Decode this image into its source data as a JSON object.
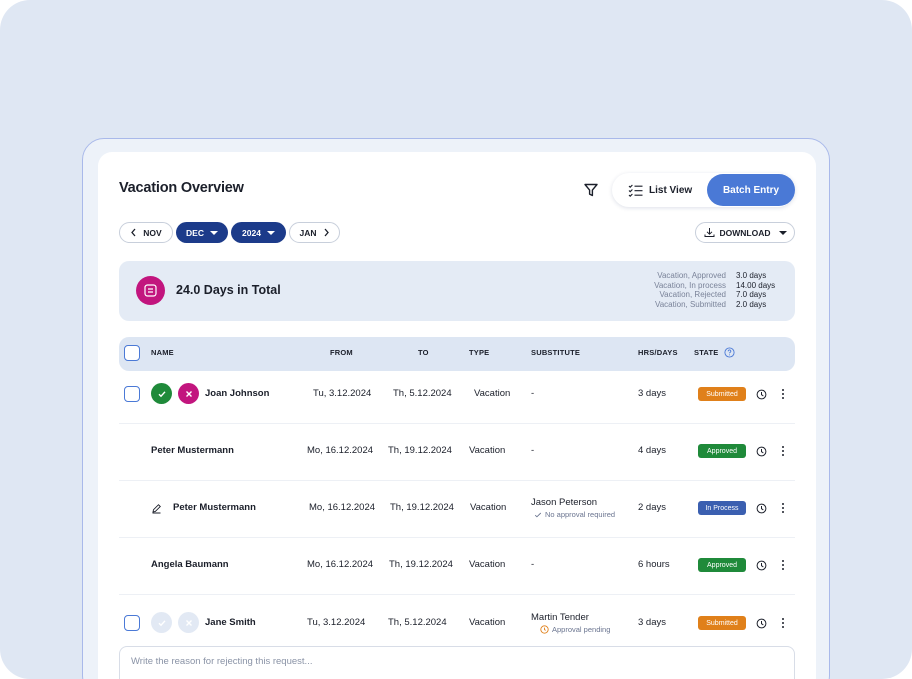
{
  "header": {
    "title": "Vacation Overview",
    "list_view_label": "List View",
    "batch_entry_label": "Batch Entry"
  },
  "period": {
    "prev_month": "NOV",
    "month": "DEC",
    "year": "2024",
    "next_month": "JAN",
    "download_label": "DOWNLOAD"
  },
  "summary": {
    "total": "24.0 Days in Total",
    "stats": [
      {
        "label": "Vacation, Approved",
        "value": "3.0 days"
      },
      {
        "label": "Vacation, In process",
        "value": "14.00 days"
      },
      {
        "label": "Vacation, Rejected",
        "value": "7.0 days"
      },
      {
        "label": "Vacation, Submitted",
        "value": "2.0 days"
      }
    ]
  },
  "table": {
    "columns": {
      "name": "NAME",
      "from": "FROM",
      "to": "TO",
      "type": "TYPE",
      "substitute": "SUBSTITUTE",
      "hrs": "HRS/DAYS",
      "state": "STATE"
    },
    "rows": [
      {
        "name": "Joan Johnson",
        "from": "Tu, 3.12.2024",
        "to": "Th, 5.12.2024",
        "type": "Vacation",
        "substitute": "-",
        "note": "",
        "hrs": "3 days",
        "state": "Submitted"
      },
      {
        "name": "Peter Mustermann",
        "from": "Mo, 16.12.2024",
        "to": "Th, 19.12.2024",
        "type": "Vacation",
        "substitute": "-",
        "note": "",
        "hrs": "4 days",
        "state": "Approved"
      },
      {
        "name": "Peter Mustermann",
        "from": "Mo, 16.12.2024",
        "to": "Th, 19.12.2024",
        "type": "Vacation",
        "substitute": "Jason Peterson",
        "note": "No approval required",
        "hrs": "2 days",
        "state": "In Process"
      },
      {
        "name": "Angela Baumann",
        "from": "Mo, 16.12.2024",
        "to": "Th, 19.12.2024",
        "type": "Vacation",
        "substitute": "-",
        "note": "",
        "hrs": "6 hours",
        "state": "Approved"
      },
      {
        "name": "Jane Smith",
        "from": "Tu, 3.12.2024",
        "to": "Th, 5.12.2024",
        "type": "Vacation",
        "substitute": "Martin Tender",
        "note": "Approval pending",
        "hrs": "3 days",
        "state": "Submitted"
      }
    ]
  },
  "reason": {
    "placeholder": "Write the reason for rejecting this request..."
  },
  "colors": {
    "accent": "#4a79d6",
    "navy": "#1c3b8a",
    "magenta": "#c2157e",
    "approved": "#1f8a3a",
    "submitted": "#e0801a",
    "in_process": "#3b5fb0"
  },
  "icons": {
    "filter": "filter-icon",
    "list": "list-icon",
    "download": "download-icon",
    "summary": "document-icon",
    "approve": "check-icon",
    "reject": "close-icon",
    "edit": "pencil-icon",
    "history": "history-icon",
    "more": "more-icon",
    "help": "help-icon"
  }
}
